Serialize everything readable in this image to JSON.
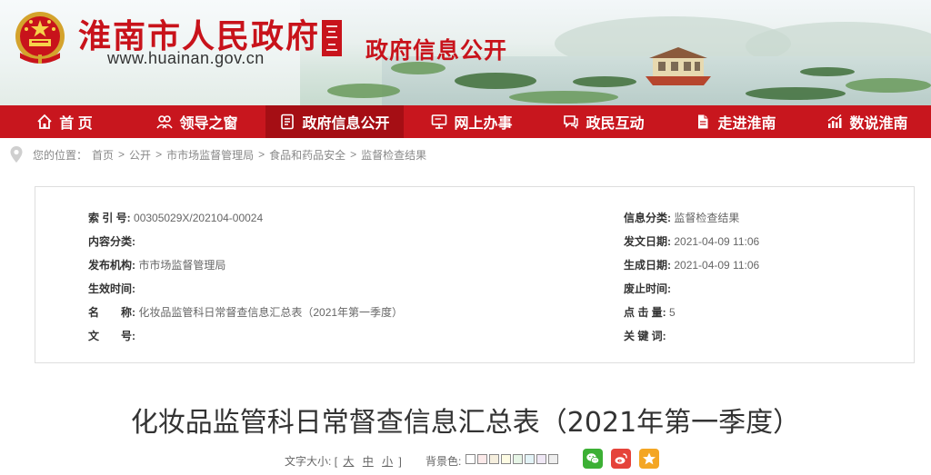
{
  "header": {
    "site_title": "淮南市人民政府",
    "site_url": "www.huainan.gov.cn",
    "section_title": "政府信息公开"
  },
  "nav": [
    {
      "label": "首 页",
      "icon": "home-icon"
    },
    {
      "label": "领导之窗",
      "icon": "leaders-icon"
    },
    {
      "label": "政府信息公开",
      "icon": "document-icon"
    },
    {
      "label": "网上办事",
      "icon": "monitor-icon"
    },
    {
      "label": "政民互动",
      "icon": "chat-icon"
    },
    {
      "label": "走进淮南",
      "icon": "file-icon"
    },
    {
      "label": "数说淮南",
      "icon": "chart-icon"
    }
  ],
  "breadcrumb": {
    "prefix": "您的位置：",
    "items": [
      "首页",
      "公开",
      "市市场监督管理局",
      "食品和药品安全",
      "监督检查结果"
    ],
    "separator": ">"
  },
  "info": {
    "index_label": "索 引 号:",
    "index_value": "00305029X/202104-00024",
    "content_cat_label": "内容分类:",
    "content_cat_value": "",
    "publisher_label": "发布机构:",
    "publisher_value": "市市场监督管理局",
    "effective_label": "生效时间:",
    "effective_value": "",
    "name_label": "名　　称:",
    "name_value": "化妆品监管科日常督查信息汇总表（2021年第一季度）",
    "docno_label": "文　　号:",
    "docno_value": "",
    "info_cat_label": "信息分类:",
    "info_cat_value": "监督检查结果",
    "pub_date_label": "发文日期:",
    "pub_date_value": "2021-04-09 11:06",
    "gen_date_label": "生成日期:",
    "gen_date_value": "2021-04-09 11:06",
    "expire_label": "废止时间:",
    "expire_value": "",
    "clicks_label": "点 击 量:",
    "clicks_value": "5",
    "keywords_label": "关 键 词:",
    "keywords_value": ""
  },
  "article": {
    "title": "化妆品监管科日常督查信息汇总表（2021年第一季度）"
  },
  "tools": {
    "font_size_label": "文字大小:",
    "bracket_open": "[",
    "size_large": "大",
    "size_medium": "中",
    "size_small": "小",
    "bracket_close": "]",
    "bg_label": "背景色:",
    "swatches": [
      "#ffffff",
      "#fbe9e9",
      "#f5eedd",
      "#fdfbe3",
      "#e6f5e6",
      "#e3f3f7",
      "#efe7f5",
      "#eeeeee"
    ]
  },
  "share": [
    {
      "icon": "wechat-icon",
      "color": "#3cb034"
    },
    {
      "icon": "weibo-icon",
      "color": "#e5433a"
    },
    {
      "icon": "qzone-icon",
      "color": "#f4a623"
    }
  ]
}
